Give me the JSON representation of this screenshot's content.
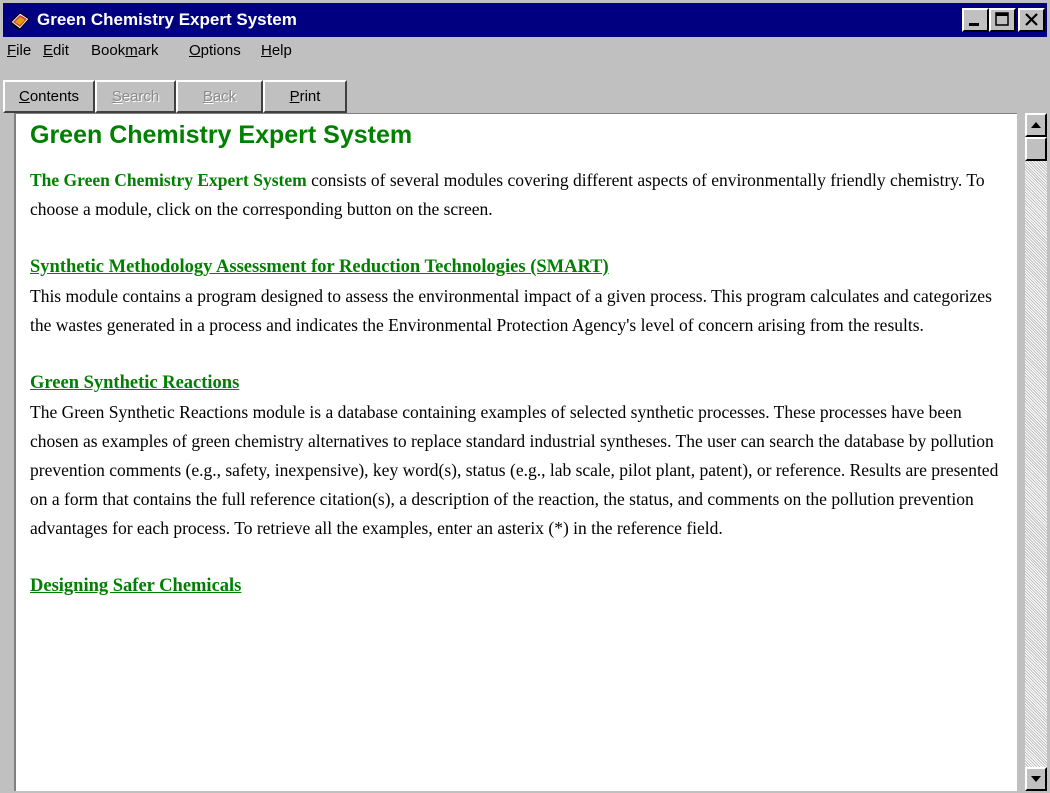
{
  "window": {
    "title": "Green Chemistry Expert System",
    "icon": "book-icon"
  },
  "menu": [
    {
      "label": "File",
      "mnemonic": "F",
      "rest": "ile"
    },
    {
      "label": "Edit",
      "mnemonic": "E",
      "rest": "dit"
    },
    {
      "label": "Bookmark",
      "pre": "Book",
      "mnemonic": "m",
      "rest": "ark"
    },
    {
      "label": "Options",
      "mnemonic": "O",
      "rest": "ptions"
    },
    {
      "label": "Help",
      "mnemonic": "H",
      "rest": "elp"
    }
  ],
  "toolbar": {
    "contents": {
      "pre": "",
      "mnemonic": "C",
      "rest": "ontents",
      "enabled": true
    },
    "search": {
      "pre": "",
      "mnemonic": "S",
      "rest": "earch",
      "enabled": false
    },
    "back": {
      "pre": "",
      "mnemonic": "B",
      "rest": "ack",
      "enabled": false
    },
    "print": {
      "pre": "",
      "mnemonic": "P",
      "rest": "rint",
      "enabled": true
    }
  },
  "content": {
    "heading": "Green Chemistry Expert System",
    "intro_lead": "The Green Chemistry Expert System",
    "intro_text": " consists of several modules covering different aspects of environmentally friendly chemistry.  To choose a module, click on the corresponding button on the screen.",
    "sections": [
      {
        "link": "Synthetic Methodology Assessment for Reduction Technologies (SMART)",
        "text": "This module contains a program designed to assess the environmental impact of a given process. This program calculates and categorizes the wastes generated in a process and indicates the Environmental Protection Agency's level of concern arising from the results."
      },
      {
        "link": "Green Synthetic Reactions",
        "text": "The Green Synthetic Reactions module is a database containing examples of selected synthetic processes.  These processes have been chosen as examples of green chemistry alternatives to replace standard industrial syntheses.  The user can search the database by pollution prevention comments (e.g., safety, inexpensive), key word(s), status (e.g., lab scale, pilot plant, patent), or reference.  Results are presented on a form that contains the full reference citation(s), a description of the reaction, the status, and comments on the pollution prevention advantages for each process.  To retrieve all the examples, enter an asterix (*) in the reference field."
      },
      {
        "link": "Designing Safer Chemicals",
        "text": ""
      }
    ]
  },
  "colors": {
    "titlebar": "#000080",
    "link_green": "#008000",
    "chrome": "#c0c0c0"
  }
}
